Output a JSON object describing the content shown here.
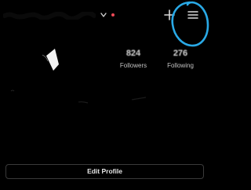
{
  "stats": {
    "followers": {
      "count": "824",
      "label": "Followers"
    },
    "following": {
      "count": "276",
      "label": "Following"
    }
  },
  "actions": {
    "edit_profile_label": "Edit Profile"
  },
  "icons": {
    "add": "plus-icon",
    "menu": "hamburger-menu-icon",
    "dropdown": "chevron-down-icon"
  },
  "colors": {
    "background": "#000000",
    "notification_dot": "#ed4956",
    "annotation_circle": "#29a9e6"
  }
}
